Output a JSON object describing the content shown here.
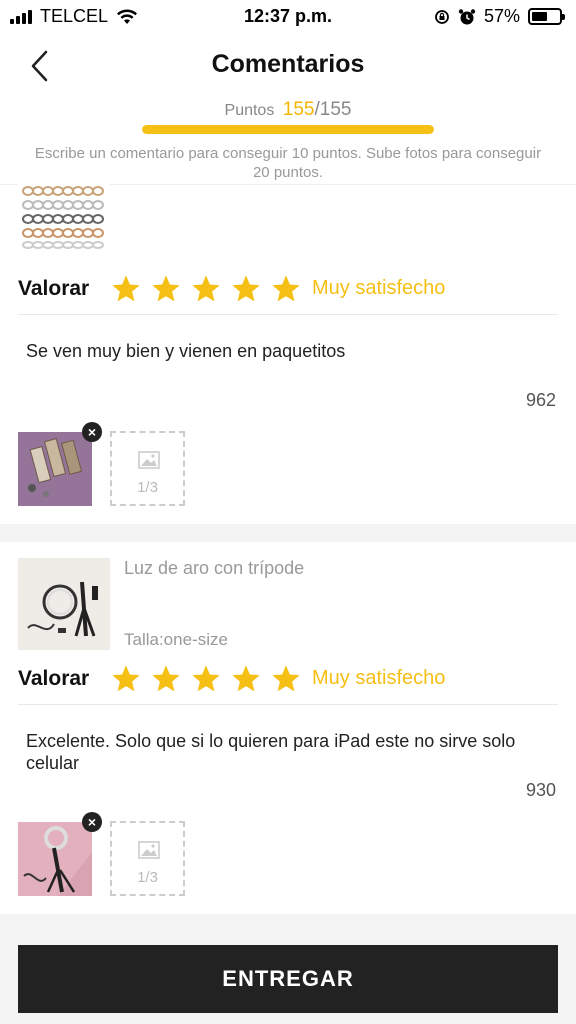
{
  "status_bar": {
    "carrier": "TELCEL",
    "time": "12:37 p.m.",
    "battery": "57%",
    "battery_level": 0.57
  },
  "header": {
    "title": "Comentarios"
  },
  "points": {
    "label": "Puntos",
    "current": "155",
    "separator": "/",
    "max": "155",
    "progress": 1.0
  },
  "hint": "Escribe un comentario para conseguir 10 puntos. Sube fotos para conseguir 20 puntos.",
  "reviews": [
    {
      "rating_label": "Valorar",
      "stars": 5,
      "rating_text": "Muy satisfecho",
      "comment": "Se ven muy bien y vienen en paquetitos",
      "char_count": "962",
      "photo_counter": "1/3"
    },
    {
      "product_name": "Luz de aro con trípode",
      "product_size": "Talla:one-size",
      "rating_label": "Valorar",
      "stars": 5,
      "rating_text": "Muy satisfecho",
      "comment": "Excelente. Solo que si lo quieren para iPad este no sirve solo celular",
      "char_count": "930",
      "photo_counter": "1/3"
    }
  ],
  "submit_label": "ENTREGAR",
  "colors": {
    "accent": "#f6bf14",
    "button": "#222222"
  },
  "icons": [
    "back-chevron-icon",
    "star-icon",
    "close-icon",
    "image-placeholder-icon",
    "wifi-icon",
    "signal-icon",
    "battery-icon",
    "alarm-icon",
    "rotation-lock-icon"
  ]
}
